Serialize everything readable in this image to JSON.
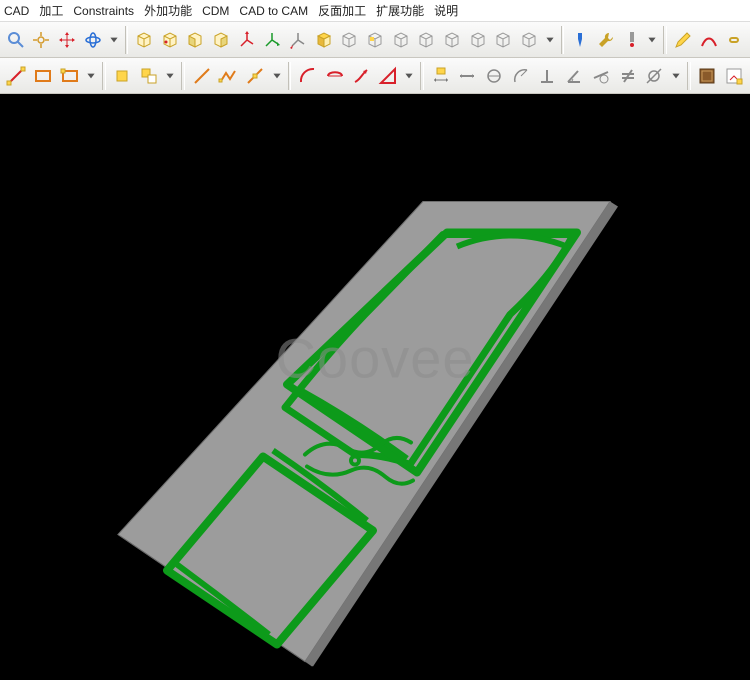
{
  "menubar": {
    "items": [
      "CAD",
      "加工",
      "Constraints",
      "外加功能",
      "CDM",
      "CAD to CAM",
      "反面加工",
      "扩展功能",
      "说明"
    ]
  },
  "toolbar_row1": {
    "icons": [
      "zoom-icon",
      "pan-icon",
      "crosshair-move-icon",
      "rotate-view-icon",
      "down-arrow-icon",
      "sep",
      "cube-front-icon",
      "cube-back-icon",
      "cube-left-icon",
      "cube-right-icon",
      "axis-xy-icon",
      "axis-xz-icon",
      "axis-yz-icon",
      "prism-icon",
      "box-iso-icon",
      "box-top-icon",
      "box-front-icon",
      "box-side-icon",
      "box-left-icon",
      "box-right-icon",
      "box-bottom-icon",
      "box-iso2-icon",
      "down-arrow-icon",
      "sep",
      "tool-blue-icon",
      "wrench-icon",
      "probe-icon",
      "down-arrow-icon",
      "sep",
      "pencil-yellow-icon",
      "curve-red-icon",
      "link-icon"
    ]
  },
  "toolbar_row2": {
    "icons": [
      "line-red-icon",
      "rect-orange-icon",
      "rect-yellow-icon",
      "down-arrow-icon",
      "sep",
      "square-yellow-icon",
      "squares-icon",
      "down-arrow-icon",
      "sep",
      "line-orange-icon",
      "zigzag-icon",
      "diagonal-icon",
      "down-arrow-icon",
      "sep",
      "arc-red-icon",
      "arc2-red-icon",
      "arc3-red-icon",
      "triangle-red-icon",
      "down-arrow-icon",
      "sep",
      "dim-yellow-icon",
      "dim-line-icon",
      "dim-arc-icon",
      "dim-radius-icon",
      "perp-icon",
      "angle-icon",
      "tangent-icon",
      "not-equal-icon",
      "parallel-icon",
      "down-arrow-icon",
      "sep",
      "panel-icon",
      "properties-icon"
    ]
  },
  "watermark": {
    "text": "Coovee"
  },
  "model": {
    "panel_color": "#9c9c9c",
    "carve_color": "#0d9a1a",
    "panel_stroke": "#6f6f6f"
  }
}
